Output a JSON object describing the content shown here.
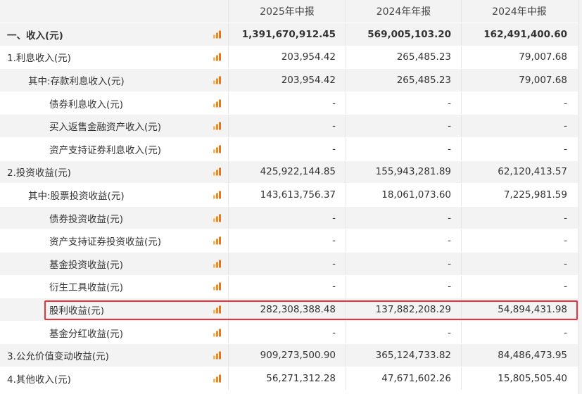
{
  "header": {
    "cols": [
      "2025年中报",
      "2024年年报",
      "2024年中报"
    ]
  },
  "rows": [
    {
      "label": "一、收入(元)",
      "level": 0,
      "bold": true,
      "alt": true,
      "values": [
        "1,391,670,912.45",
        "569,005,103.20",
        "162,491,400.60"
      ]
    },
    {
      "label": "1.利息收入(元)",
      "level": 0,
      "bold": false,
      "alt": false,
      "values": [
        "203,954.42",
        "265,485.23",
        "79,007.68"
      ]
    },
    {
      "label": "其中:存款利息收入(元)",
      "level": 1,
      "bold": false,
      "alt": true,
      "values": [
        "203,954.42",
        "265,485.23",
        "79,007.68"
      ]
    },
    {
      "label": "债券利息收入(元)",
      "level": 2,
      "bold": false,
      "alt": false,
      "values": [
        "-",
        "-",
        "-"
      ]
    },
    {
      "label": "买入返售金融资产收入(元)",
      "level": 2,
      "bold": false,
      "alt": true,
      "values": [
        "-",
        "-",
        "-"
      ]
    },
    {
      "label": "资产支持证券利息收入(元)",
      "level": 2,
      "bold": false,
      "alt": false,
      "values": [
        "-",
        "-",
        "-"
      ]
    },
    {
      "label": "2.投资收益(元)",
      "level": 0,
      "bold": false,
      "alt": true,
      "values": [
        "425,922,144.85",
        "155,943,281.89",
        "62,120,413.57"
      ]
    },
    {
      "label": "其中:股票投资收益(元)",
      "level": 1,
      "bold": false,
      "alt": false,
      "values": [
        "143,613,756.37",
        "18,061,073.60",
        "7,225,981.59"
      ]
    },
    {
      "label": "债券投资收益(元)",
      "level": 2,
      "bold": false,
      "alt": true,
      "values": [
        "-",
        "-",
        "-"
      ]
    },
    {
      "label": "资产支持证券投资收益(元)",
      "level": 2,
      "bold": false,
      "alt": false,
      "values": [
        "-",
        "-",
        "-"
      ]
    },
    {
      "label": "基金投资收益(元)",
      "level": 2,
      "bold": false,
      "alt": true,
      "values": [
        "-",
        "-",
        "-"
      ]
    },
    {
      "label": "衍生工具收益(元)",
      "level": 2,
      "bold": false,
      "alt": false,
      "values": [
        "-",
        "-",
        "-"
      ]
    },
    {
      "label": "股利收益(元)",
      "level": 2,
      "bold": false,
      "alt": true,
      "values": [
        "282,308,388.48",
        "137,882,208.29",
        "54,894,431.98"
      ]
    },
    {
      "label": "基金分红收益(元)",
      "level": 2,
      "bold": false,
      "alt": false,
      "values": [
        "-",
        "-",
        "-"
      ]
    },
    {
      "label": "3.公允价值变动收益(元)",
      "level": 0,
      "bold": false,
      "alt": true,
      "values": [
        "909,273,500.90",
        "365,124,733.82",
        "84,486,473.95"
      ]
    },
    {
      "label": "4.其他收入(元)",
      "level": 0,
      "bold": false,
      "alt": false,
      "values": [
        "56,271,312.28",
        "47,671,602.26",
        "15,805,505.40"
      ]
    }
  ],
  "colors": {
    "highlight": "#e8333a",
    "icon": "#f08a24",
    "stripe": "#f3f3f3"
  },
  "icons": {
    "row_chart": "bar-chart-icon"
  }
}
